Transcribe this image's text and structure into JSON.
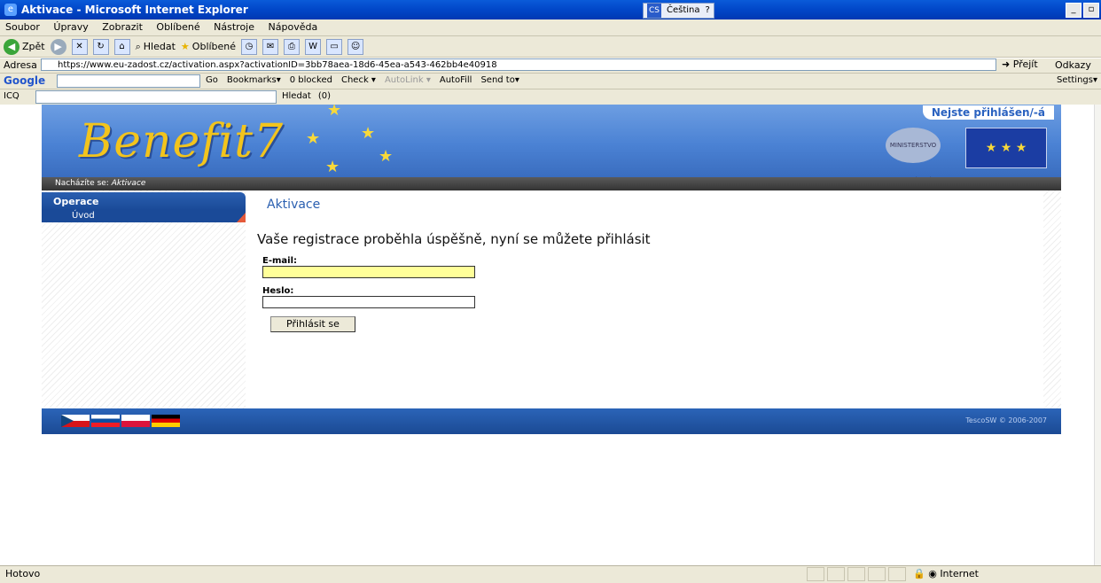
{
  "window": {
    "title": "Aktivace - Microsoft Internet Explorer",
    "lang_label": "Čeština",
    "lang_code": "CS"
  },
  "menu": [
    "Soubor",
    "Úpravy",
    "Zobrazit",
    "Oblíbené",
    "Nástroje",
    "Nápověda"
  ],
  "toolbar": {
    "back": "Zpět",
    "search": "Hledat",
    "favorites": "Oblíbené"
  },
  "address": {
    "label": "Adresa",
    "url": "https://www.eu-zadost.cz/activation.aspx?activationID=3bb78aea-18d6-45ea-a543-462bb4e40918",
    "go": "Přejít",
    "links": "Odkazy"
  },
  "google_bar": {
    "brand": "Google",
    "go": "Go",
    "bookmarks": "Bookmarks▾",
    "blocked": "0 blocked",
    "check": "Check ▾",
    "autolink": "AutoLink ▾",
    "autofill": "AutoFill",
    "sendto": "Send to▾",
    "settings": "Settings▾"
  },
  "icq_bar": {
    "label": "ICQ",
    "search": "Hledat",
    "count": "(0)"
  },
  "site": {
    "logo": "Benefit7",
    "login_status": "Nejste přihlášen/-á",
    "ministry_logo": "MINISTERSTVO PRO MÍSTNÍ ROZVOJ",
    "breadcrumb_label": "Nacházíte se:",
    "breadcrumb_current": "Aktivace",
    "sidebar_title": "Operace",
    "sidebar_item": "Úvod",
    "page_title": "Aktivace",
    "message": "Vaše registrace proběhla úspěšně, nyní se můžete přihlásit",
    "email_label": "E-mail:",
    "password_label": "Heslo:",
    "login_button": "Přihlásit se",
    "copyright": "TescoSW © 2006-2007"
  },
  "colors": {
    "email_field_bg": "#ffff99",
    "header_blue": "#4b82d4",
    "footer_blue": "#1b4a94"
  },
  "status": {
    "left": "Hotovo",
    "zone": "Internet"
  }
}
